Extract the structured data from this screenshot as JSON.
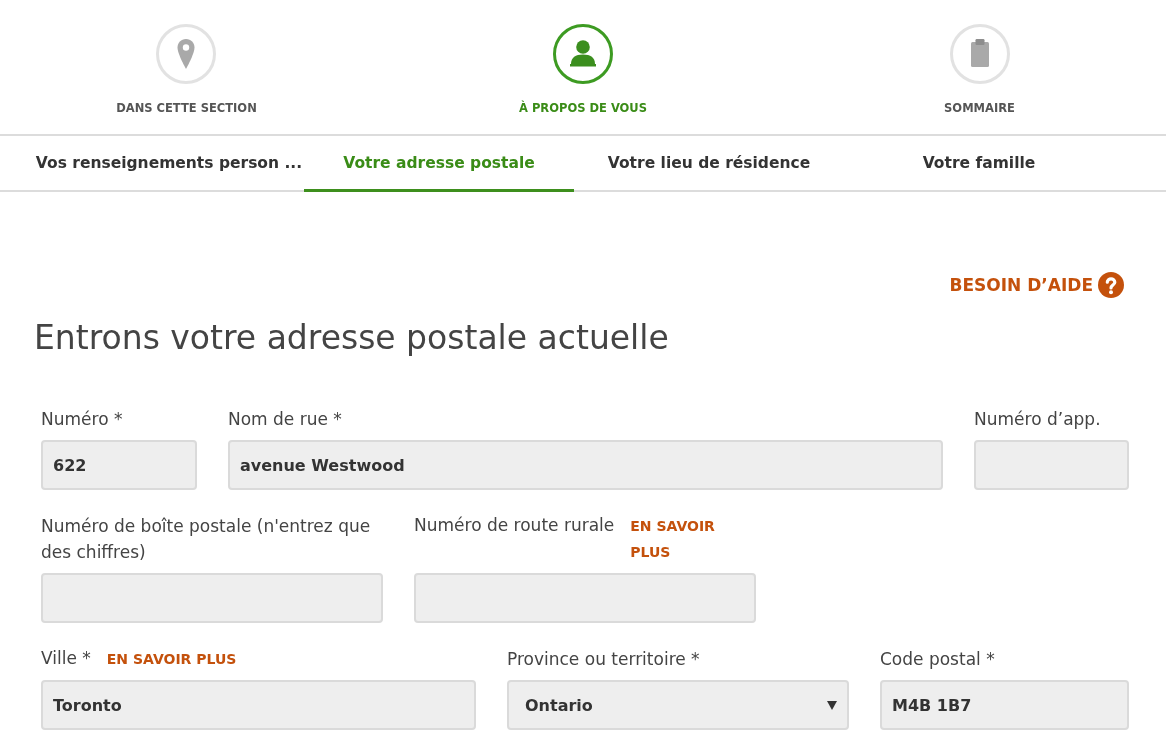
{
  "steps": [
    {
      "label": "DANS CETTE SECTION",
      "selected": false
    },
    {
      "label": "À PROPOS DE VOUS",
      "selected": true
    },
    {
      "label": "SOMMAIRE",
      "selected": false
    }
  ],
  "tabs": [
    {
      "label": "Vos renseignements person ...",
      "selected": false
    },
    {
      "label": "Votre adresse postale",
      "selected": true
    },
    {
      "label": "Votre lieu de résidence",
      "selected": false
    },
    {
      "label": "Votre famille",
      "selected": false
    }
  ],
  "help_link": {
    "label": "BESOIN D’AIDE"
  },
  "heading": "Entrons votre adresse postale actuelle",
  "form": {
    "rows": [
      {
        "fields": [
          {
            "kind": "text",
            "label": "Numéro *",
            "value": "622"
          },
          {
            "kind": "text",
            "label": "Nom de rue *",
            "value": "avenue Westwood"
          },
          {
            "kind": "text",
            "label": "Numéro d’app."
          }
        ]
      },
      {
        "fields": [
          {
            "kind": "text",
            "label": "Numéro de boîte postale (n'entrez que des chiffres)"
          },
          {
            "kind": "text",
            "label": "Numéro de route rurale",
            "link": "EN SAVOIR PLUS"
          }
        ]
      },
      {
        "fields": [
          {
            "kind": "text",
            "label": "Ville *",
            "link": "EN SAVOIR PLUS",
            "value": "Toronto"
          },
          {
            "kind": "select",
            "label": "Province ou territoire *",
            "value": "Ontario"
          },
          {
            "kind": "text",
            "label": "Code postal *",
            "value": "M4B 1B7"
          }
        ]
      }
    ]
  }
}
